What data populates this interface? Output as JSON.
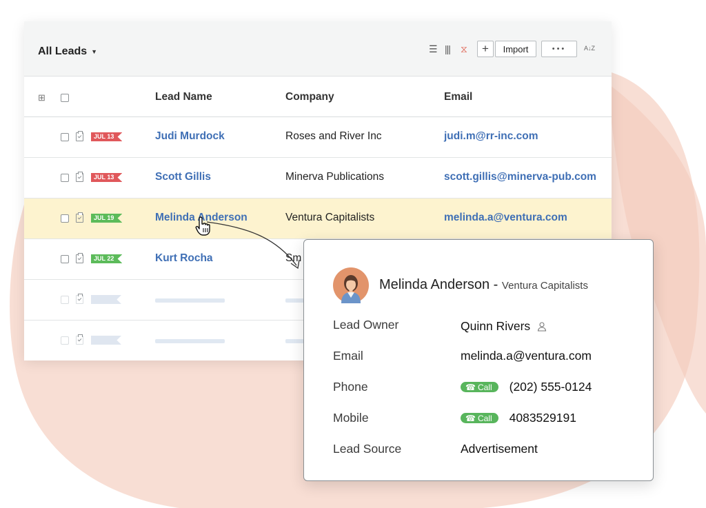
{
  "header": {
    "view_title": "All Leads",
    "import_label": "Import",
    "more_label": "•••",
    "sort_glyph": "A↓Z"
  },
  "columns": [
    "Lead Name",
    "Company",
    "Email"
  ],
  "rows": [
    {
      "tag": "JUL 13",
      "tag_color": "#e0585b",
      "name": "Judi Murdock",
      "company": "Roses and River Inc",
      "email": "judi.m@rr-inc.com"
    },
    {
      "tag": "JUL 13",
      "tag_color": "#e0585b",
      "name": "Scott Gillis",
      "company": "Minerva Publications",
      "email": "scott.gillis@minerva-pub.com"
    },
    {
      "tag": "JUL 19",
      "tag_color": "#5cbb5a",
      "name": "Melinda Anderson",
      "company": "Ventura Capitalists",
      "email": "melinda.a@ventura.com"
    },
    {
      "tag": "JUL 22",
      "tag_color": "#5cbb5a",
      "name": "Kurt Rocha",
      "company": "Sm",
      "email": ""
    }
  ],
  "card": {
    "name": "Melinda Anderson",
    "separator": " - ",
    "company": "Ventura Capitalists",
    "fields": [
      {
        "label": "Lead Owner",
        "value": "Quinn Rivers"
      },
      {
        "label": "Email",
        "value": "melinda.a@ventura.com"
      },
      {
        "label": "Phone",
        "value": "(202) 555-0124",
        "call_label": "Call"
      },
      {
        "label": "Mobile",
        "value": "4083529191",
        "call_label": "Call"
      },
      {
        "label": "Lead Source",
        "value": "Advertisement"
      }
    ]
  },
  "colors": {
    "link": "#3f6fb5",
    "highlight_row": "#fdf3cf",
    "overdue_tag": "#e0585b",
    "upcoming_tag": "#5cbb5a",
    "call_badge": "#58b55c",
    "background_blob": "#f7d8cd"
  }
}
